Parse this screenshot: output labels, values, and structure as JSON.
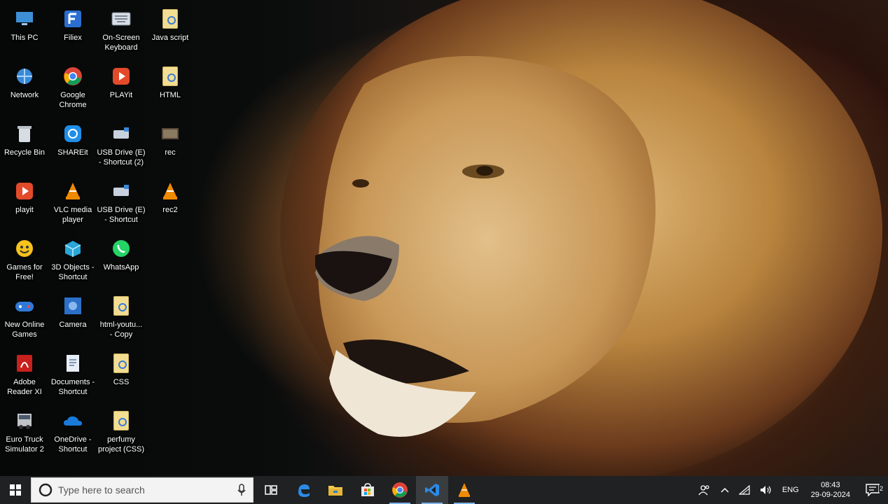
{
  "desktop": {
    "icons": [
      {
        "label": "This PC",
        "icon": "this-pc-icon"
      },
      {
        "label": "Filiex",
        "icon": "filiex-icon"
      },
      {
        "label": "On-Screen\nKeyboard",
        "icon": "keyboard-icon"
      },
      {
        "label": "Java script",
        "icon": "folder-icon"
      },
      {
        "label": "Network",
        "icon": "network-icon"
      },
      {
        "label": "Google\nChrome",
        "icon": "chrome-icon"
      },
      {
        "label": "PLAYit",
        "icon": "playit-icon"
      },
      {
        "label": "HTML",
        "icon": "folder-icon"
      },
      {
        "label": "Recycle Bin",
        "icon": "recycle-bin-icon"
      },
      {
        "label": "SHAREit",
        "icon": "shareit-icon"
      },
      {
        "label": "USB Drive (E)\n- Shortcut (2)",
        "icon": "usb-drive-icon"
      },
      {
        "label": "rec",
        "icon": "video-file-icon"
      },
      {
        "label": "playit",
        "icon": "playit-icon"
      },
      {
        "label": "VLC media\nplayer",
        "icon": "vlc-icon"
      },
      {
        "label": "USB Drive (E)\n- Shortcut",
        "icon": "usb-drive-icon"
      },
      {
        "label": "rec2",
        "icon": "vlc-icon"
      },
      {
        "label": "Games for\nFree!",
        "icon": "games-icon"
      },
      {
        "label": "3D Objects -\nShortcut",
        "icon": "3d-objects-icon"
      },
      {
        "label": "WhatsApp",
        "icon": "whatsapp-icon"
      },
      {
        "label": "New Online\nGames",
        "icon": "online-games-icon"
      },
      {
        "label": "Camera",
        "icon": "camera-icon"
      },
      {
        "label": "html-youtu...\n- Copy",
        "icon": "folder-icon"
      },
      {
        "label": "Adobe\nReader XI",
        "icon": "adobe-reader-icon"
      },
      {
        "label": "Documents -\nShortcut",
        "icon": "documents-icon"
      },
      {
        "label": "CSS",
        "icon": "folder-icon"
      },
      {
        "label": "Euro Truck\nSimulator 2",
        "icon": "truck-icon"
      },
      {
        "label": "OneDrive -\nShortcut",
        "icon": "onedrive-icon"
      },
      {
        "label": "perfumy\nproject (CSS)",
        "icon": "folder-icon"
      }
    ]
  },
  "taskbar": {
    "search_placeholder": "Type here to search",
    "apps": [
      "task-view",
      "edge",
      "file-explorer",
      "store",
      "chrome",
      "vscode",
      "vlc"
    ],
    "tray": {
      "language": "ENG",
      "time": "08:43",
      "date": "29-09-2024",
      "notification_count": "2"
    }
  }
}
